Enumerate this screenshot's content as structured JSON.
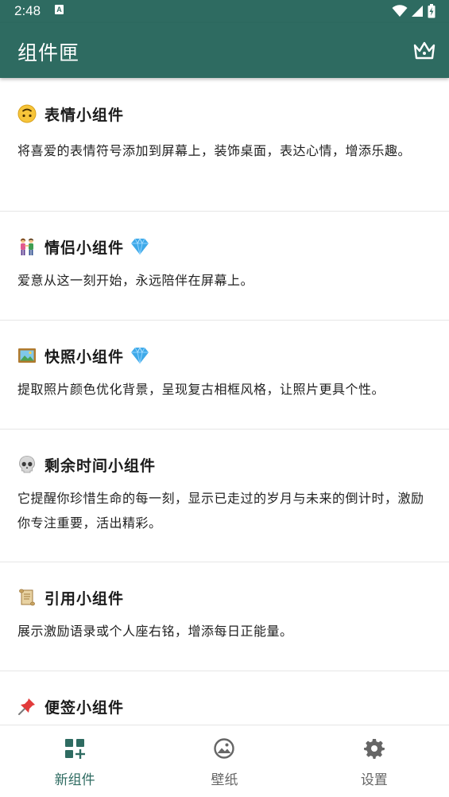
{
  "status_bar": {
    "time": "2:48",
    "notification_icon": "a-letter-icon",
    "icons": [
      "wifi-icon",
      "signal-icon",
      "battery-charging-icon"
    ]
  },
  "app_bar": {
    "title": "组件匣",
    "action_icon": "crown-icon"
  },
  "cards": [
    {
      "emoji": "upside-down-face-icon",
      "title": "表情小组件",
      "premium": false,
      "description": "将喜爱的表情符号添加到屏幕上，装饰桌面，表达心情，增添乐趣。"
    },
    {
      "emoji": "couple-icon",
      "title": "情侣小组件",
      "premium": true,
      "description": "爱意从这一刻开始，永远陪伴在屏幕上。"
    },
    {
      "emoji": "framed-picture-icon",
      "title": "快照小组件",
      "premium": true,
      "description": "提取照片颜色优化背景，呈现复古相框风格，让照片更具个性。"
    },
    {
      "emoji": "skull-icon",
      "title": "剩余时间小组件",
      "premium": false,
      "description": "它提醒你珍惜生命的每一刻，显示已走过的岁月与未来的倒计时，激励你专注重要，活出精彩。"
    },
    {
      "emoji": "scroll-icon",
      "title": "引用小组件",
      "premium": false,
      "description": "展示激励语录或个人座右铭，增添每日正能量。"
    },
    {
      "emoji": "pushpin-icon",
      "title": "便签小组件",
      "premium": false,
      "description": ""
    }
  ],
  "bottom_nav": {
    "items": [
      {
        "label": "新组件",
        "icon": "widgets-add-icon",
        "active": true
      },
      {
        "label": "壁纸",
        "icon": "wallpaper-icon",
        "active": false
      },
      {
        "label": "设置",
        "icon": "gear-icon",
        "active": false
      }
    ]
  },
  "colors": {
    "primary": "#2e6b61",
    "nav_inactive": "#666666",
    "gem": "#3fa9e8"
  }
}
